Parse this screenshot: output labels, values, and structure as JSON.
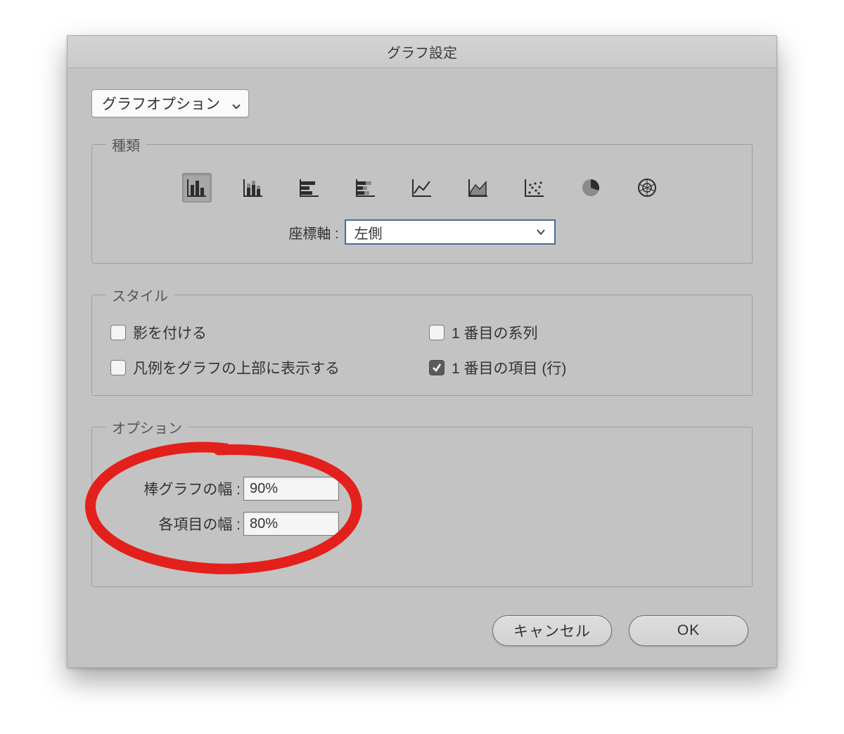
{
  "dialog": {
    "title": "グラフ設定",
    "category_selected": "グラフオプション",
    "type_group": {
      "legend": "種類",
      "axis_label": "座標軸 :",
      "axis_value": "左側",
      "icons": [
        {
          "name": "column-graph-icon",
          "selected": true
        },
        {
          "name": "stacked-column-graph-icon",
          "selected": false
        },
        {
          "name": "bar-graph-icon",
          "selected": false
        },
        {
          "name": "stacked-bar-graph-icon",
          "selected": false
        },
        {
          "name": "line-graph-icon",
          "selected": false
        },
        {
          "name": "area-graph-icon",
          "selected": false
        },
        {
          "name": "scatter-graph-icon",
          "selected": false
        },
        {
          "name": "pie-graph-icon",
          "selected": false
        },
        {
          "name": "radar-graph-icon",
          "selected": false
        }
      ]
    },
    "style_group": {
      "legend": "スタイル",
      "items": [
        {
          "label": "影を付ける",
          "checked": false
        },
        {
          "label": "1 番目の系列",
          "checked": false
        },
        {
          "label": "凡例をグラフの上部に表示する",
          "checked": false
        },
        {
          "label": "1 番目の項目 (行)",
          "checked": true
        }
      ]
    },
    "options_group": {
      "legend": "オプション",
      "bar_width_label": "棒グラフの幅 :",
      "bar_width_value": "90%",
      "cluster_width_label": "各項目の幅 :",
      "cluster_width_value": "80%"
    },
    "buttons": {
      "cancel": "キャンセル",
      "ok": "OK"
    }
  }
}
